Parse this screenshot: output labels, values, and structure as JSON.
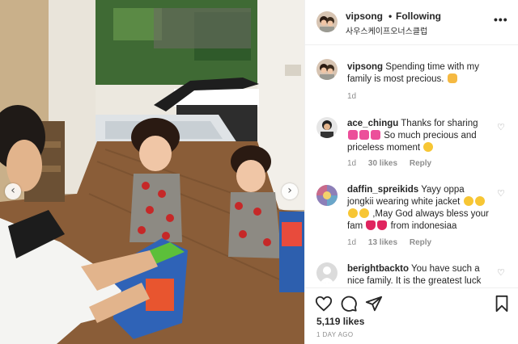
{
  "post": {
    "username": "vipsong",
    "follow_label": "Following",
    "subtitle": "사우스케이프오너스클럽",
    "more_icon": "more-dots-icon"
  },
  "comments": [
    {
      "username": "vipsong",
      "text": "Spending time with my family is most precious.",
      "emoji": [
        "hand-emoji"
      ],
      "age": "1d",
      "likes": "",
      "reply": ""
    },
    {
      "username": "ace_chingu",
      "text_a": "Thanks for sharing",
      "text_b": "So much precious and priceless moment",
      "emoji": [
        "hearts-emoji",
        "hearts-emoji",
        "hearts-emoji",
        "face-emoji"
      ],
      "age": "1d",
      "likes": "30 likes",
      "reply": "Reply"
    },
    {
      "username": "daffin_spreikids",
      "text_a": "Yayy oppa jongkii wearing white jacket",
      "text_b": ",May God always bless your fam",
      "text_c": "from indonesiaa",
      "emoji": [
        "face-emoji",
        "red-heart-emoji"
      ],
      "age": "1d",
      "likes": "13 likes",
      "reply": "Reply"
    },
    {
      "username": "berightbackto",
      "text": "You have such a nice family. It is the greatest luck",
      "age": "",
      "likes": "",
      "reply": ""
    }
  ],
  "actions": {
    "like_icon": "heart-icon",
    "comment_icon": "comment-icon",
    "share_icon": "share-icon",
    "save_icon": "bookmark-icon",
    "likes_count": "5,119 likes",
    "timestamp": "1 DAY AGO"
  },
  "photo": {
    "prev_icon": "chevron-left-icon",
    "next_icon": "chevron-right-icon",
    "prev_glyph": "‹",
    "next_glyph": "›"
  }
}
